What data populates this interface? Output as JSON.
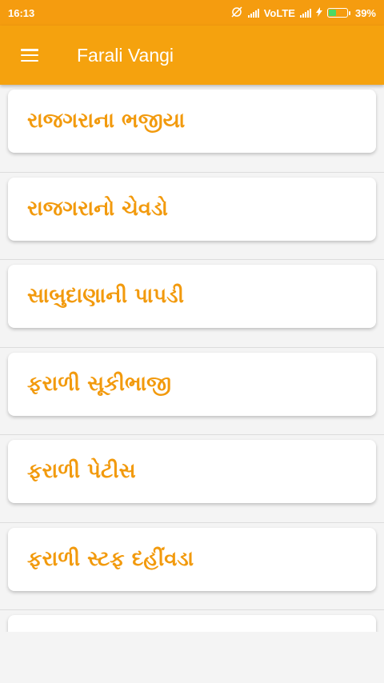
{
  "status_bar": {
    "time": "16:13",
    "network": "VoLTE",
    "battery_percent": "39%",
    "battery_level": 0.39
  },
  "app_bar": {
    "title": "Farali Vangi",
    "menu_icon": "hamburger-menu-icon"
  },
  "recipes": [
    {
      "label": "રાજગરાના ભજીયા"
    },
    {
      "label": "રાજગરાનો ચેવડો"
    },
    {
      "label": "સાબુદાણાની પાપડી"
    },
    {
      "label": "ફરાળી સૂકીભાજી"
    },
    {
      "label": "ફરાળી પેટીસ"
    },
    {
      "label": "ફરાળી સ્ટફ દહીંવડા"
    },
    {
      "label": ""
    }
  ],
  "colors": {
    "primary": "#f5a20e",
    "status_bar": "#f59c0f",
    "accent_text": "#f29a0d",
    "background": "#f4f4f4"
  }
}
